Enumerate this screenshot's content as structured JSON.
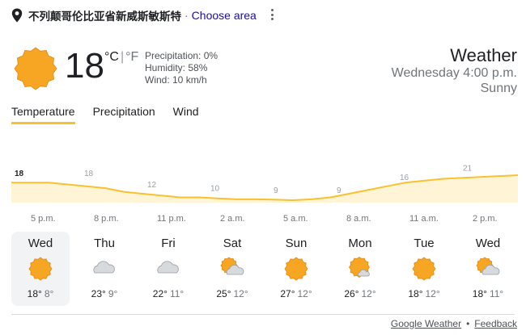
{
  "location": {
    "name": "不列颠哥伦比亚省新威斯敏斯特",
    "separator": "·",
    "choose_label": "Choose area"
  },
  "current": {
    "temperature": "18",
    "unit_c": "°C",
    "unit_sep": "|",
    "unit_f": "°F",
    "precipitation": "Precipitation: 0%",
    "humidity": "Humidity: 58%",
    "wind": "Wind: 10 km/h",
    "icon": "sun-icon"
  },
  "header": {
    "title": "Weather",
    "time": "Wednesday 4:00 p.m.",
    "condition": "Sunny"
  },
  "tabs": [
    {
      "label": "Temperature",
      "active": true
    },
    {
      "label": "Precipitation",
      "active": false
    },
    {
      "label": "Wind",
      "active": false
    }
  ],
  "chart_data": {
    "type": "area",
    "points": [
      18,
      18,
      18,
      17,
      16,
      15,
      13,
      12,
      11,
      10,
      10,
      9.5,
      9,
      9,
      8.8,
      8.5,
      9,
      10,
      12,
      14,
      16,
      18,
      19,
      20,
      20.5,
      21,
      21.5,
      22
    ],
    "labels": [
      "18",
      "18",
      "12",
      "10",
      "9",
      "9",
      "16",
      "21"
    ],
    "label_values": [
      18,
      18,
      12,
      10,
      9,
      9,
      16,
      21
    ],
    "hours": [
      "5 p.m.",
      "8 p.m.",
      "11 p.m.",
      "2 a.m.",
      "5 a.m.",
      "8 a.m.",
      "11 a.m.",
      "2 p.m."
    ],
    "line_color": "#fbc02d",
    "fill_color": "#fff5d6"
  },
  "days": [
    {
      "name": "Wed",
      "icon": "sun-icon",
      "high": "18°",
      "low": "8°",
      "selected": true
    },
    {
      "name": "Thu",
      "icon": "cloud-icon",
      "high": "23°",
      "low": "9°",
      "selected": false
    },
    {
      "name": "Fri",
      "icon": "cloud-icon",
      "high": "22°",
      "low": "11°",
      "selected": false
    },
    {
      "name": "Sat",
      "icon": "partly-cloudy-icon",
      "high": "25°",
      "low": "12°",
      "selected": false
    },
    {
      "name": "Sun",
      "icon": "sun-icon",
      "high": "27°",
      "low": "12°",
      "selected": false
    },
    {
      "name": "Mon",
      "icon": "sun-small-cloud-icon",
      "high": "26°",
      "low": "12°",
      "selected": false
    },
    {
      "name": "Tue",
      "icon": "sun-icon",
      "high": "18°",
      "low": "12°",
      "selected": false
    },
    {
      "name": "Wed",
      "icon": "partly-cloudy-icon",
      "high": "18°",
      "low": "11°",
      "selected": false
    }
  ],
  "footer": {
    "source_label": "Google Weather",
    "separator": "•",
    "feedback_label": "Feedback"
  },
  "colors": {
    "sun": "#f6a623",
    "sun_stroke": "#e8901a",
    "cloud": "#c9cdd1"
  }
}
